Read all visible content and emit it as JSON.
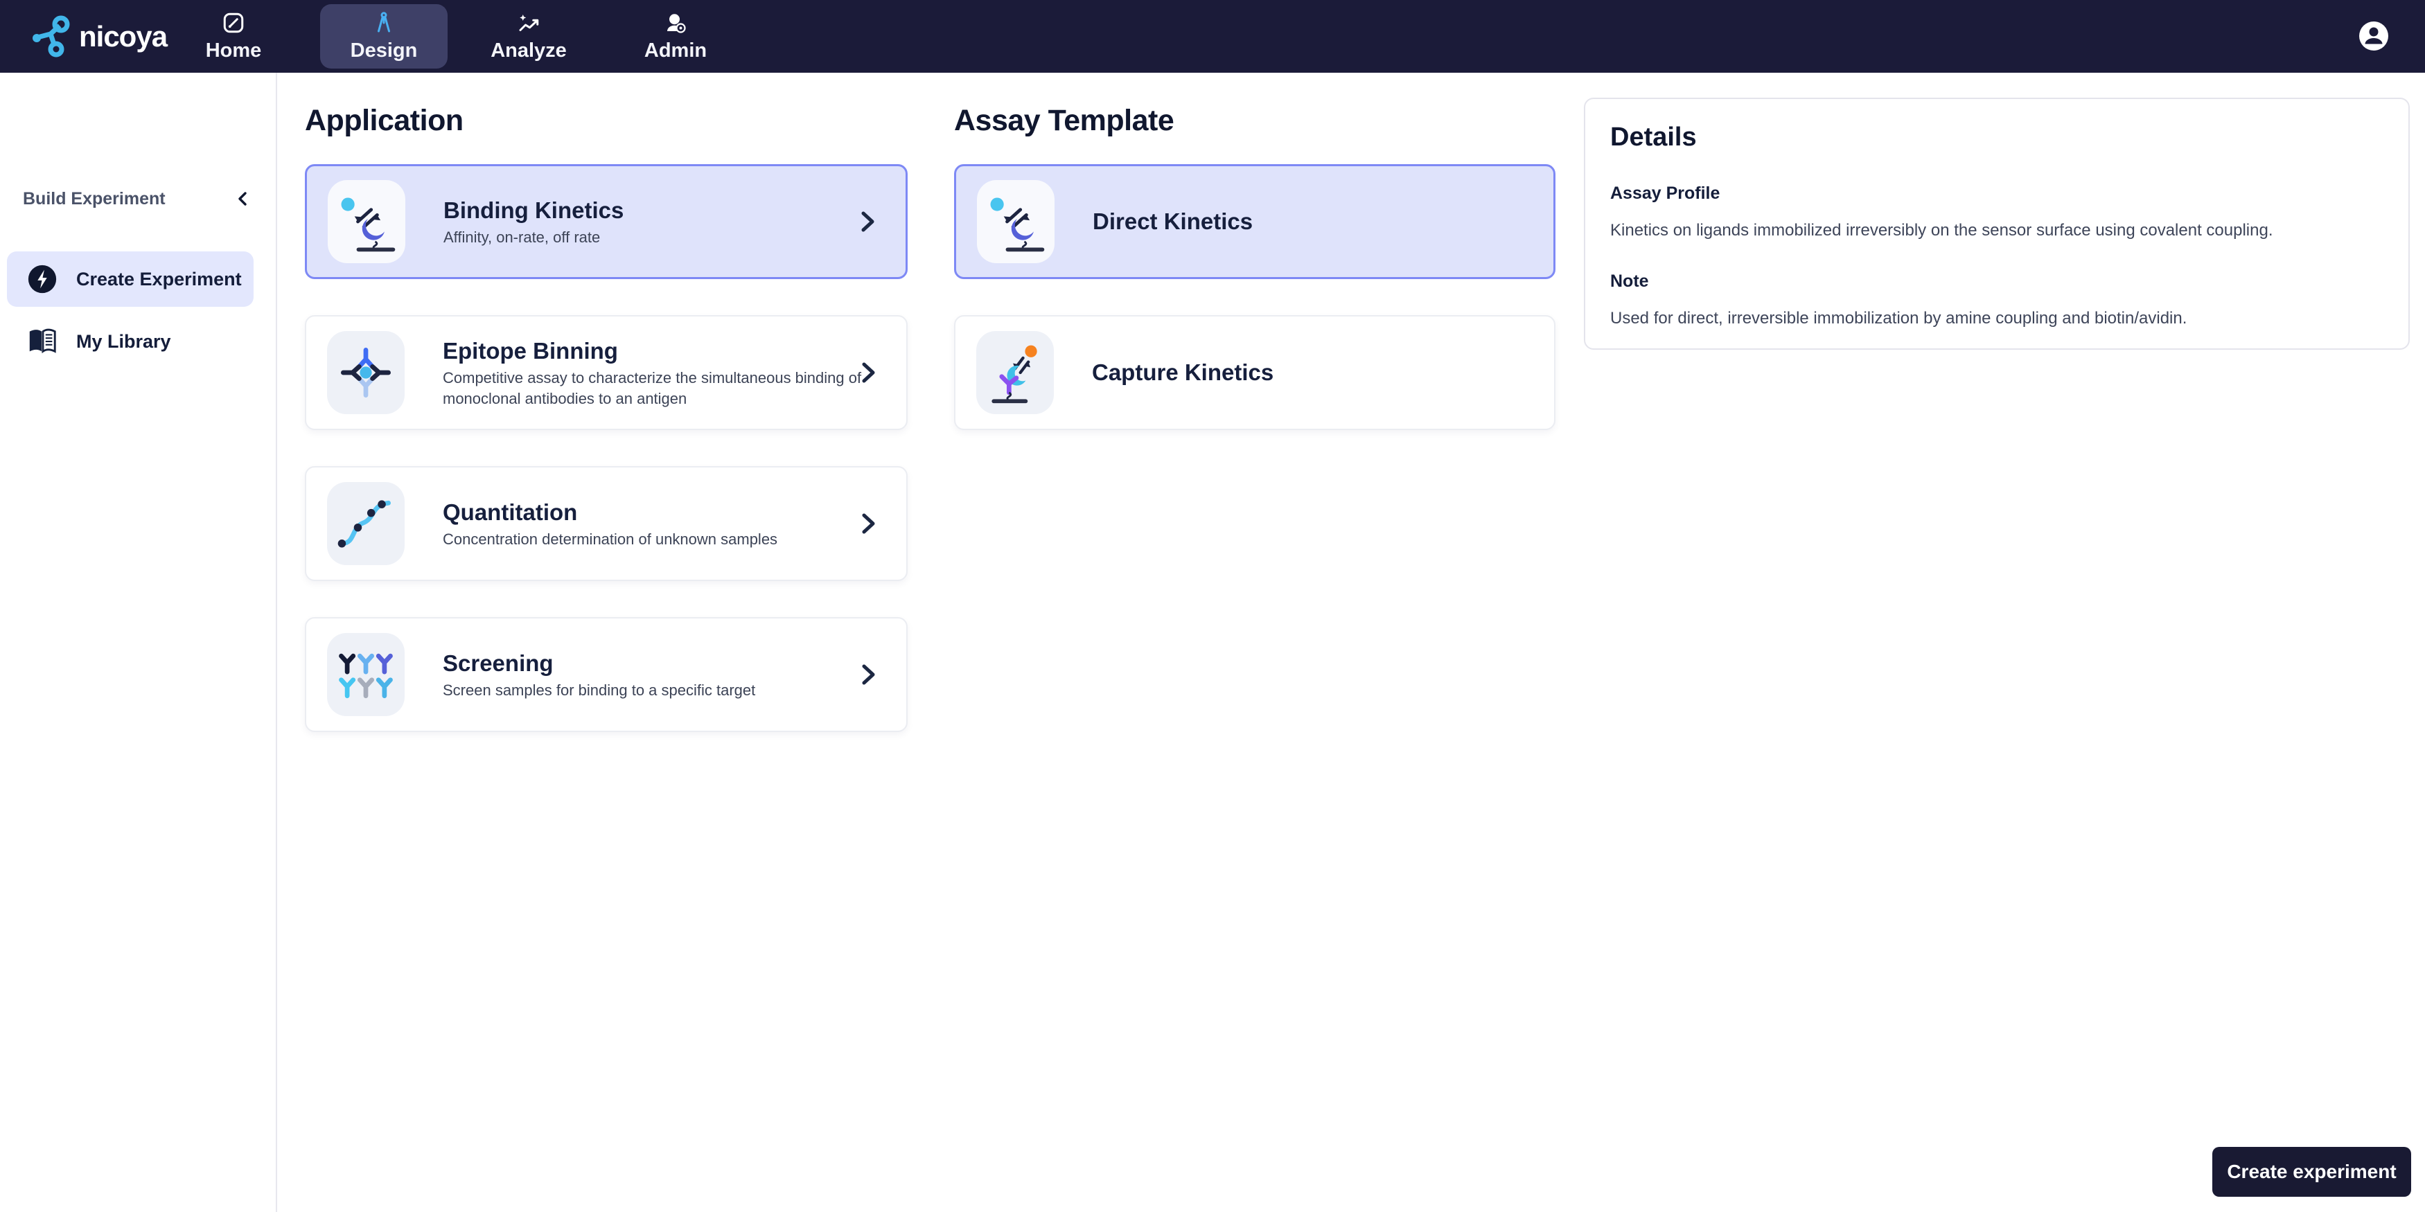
{
  "navbar": {
    "logo_text": "nicoya",
    "tabs": [
      {
        "label": "Home",
        "icon": "gauge-icon",
        "active": false
      },
      {
        "label": "Design",
        "icon": "compass-icon",
        "active": true
      },
      {
        "label": "Analyze",
        "icon": "trend-sparkle-icon",
        "active": false
      },
      {
        "label": "Admin",
        "icon": "user-gear-icon",
        "active": false
      }
    ],
    "account_icon": "account-icon"
  },
  "sidebar": {
    "section_label": "Build Experiment",
    "collapse_icon": "chevron-left-icon",
    "items": [
      {
        "label": "Create Experiment",
        "icon": "lightning-circle-icon",
        "active": true
      },
      {
        "label": "My Library",
        "icon": "book-icon",
        "active": false
      }
    ]
  },
  "application": {
    "heading": "Application",
    "cards": [
      {
        "title": "Binding Kinetics",
        "description": "Affinity, on-rate, off rate",
        "icon": "binding-kinetics-icon",
        "selected": true
      },
      {
        "title": "Epitope Binning",
        "description": "Competitive assay to characterize the simultaneous binding of monoclonal antibodies to an antigen",
        "icon": "epitope-binning-icon",
        "selected": false
      },
      {
        "title": "Quantitation",
        "description": "Concentration determination of unknown samples",
        "icon": "quantitation-icon",
        "selected": false
      },
      {
        "title": "Screening",
        "description": "Screen samples for binding to a specific target",
        "icon": "screening-icon",
        "selected": false
      }
    ]
  },
  "assay_template": {
    "heading": "Assay Template",
    "cards": [
      {
        "title": "Direct Kinetics",
        "icon": "direct-kinetics-icon",
        "selected": true
      },
      {
        "title": "Capture Kinetics",
        "icon": "capture-kinetics-icon",
        "selected": false
      }
    ]
  },
  "details": {
    "heading": "Details",
    "sections": [
      {
        "label": "Assay Profile",
        "text": "Kinetics on ligands immobilized irreversibly on the sensor surface using covalent coupling."
      },
      {
        "label": "Note",
        "text": "Used for direct, irreversible immobilization by amine coupling and biotin/avidin."
      }
    ]
  },
  "footer": {
    "create_button_label": "Create experiment"
  },
  "colors": {
    "navbar_bg": "#1b1b39",
    "nav_active_pill": "#3e4067",
    "accent_cyan": "#49b0f2",
    "selected_card_bg": "#dfe3fb",
    "selected_card_border": "#7e89f5",
    "sidebar_active_bg": "#e3e7fd",
    "icon_tile_bg": "#eef1f7",
    "heading_text": "#10172f",
    "body_text": "#3c4356",
    "button_bg": "#191a33",
    "icon_indigo": "#5560d8",
    "icon_orange": "#f6821f",
    "icon_cyan": "#45c6f1"
  }
}
